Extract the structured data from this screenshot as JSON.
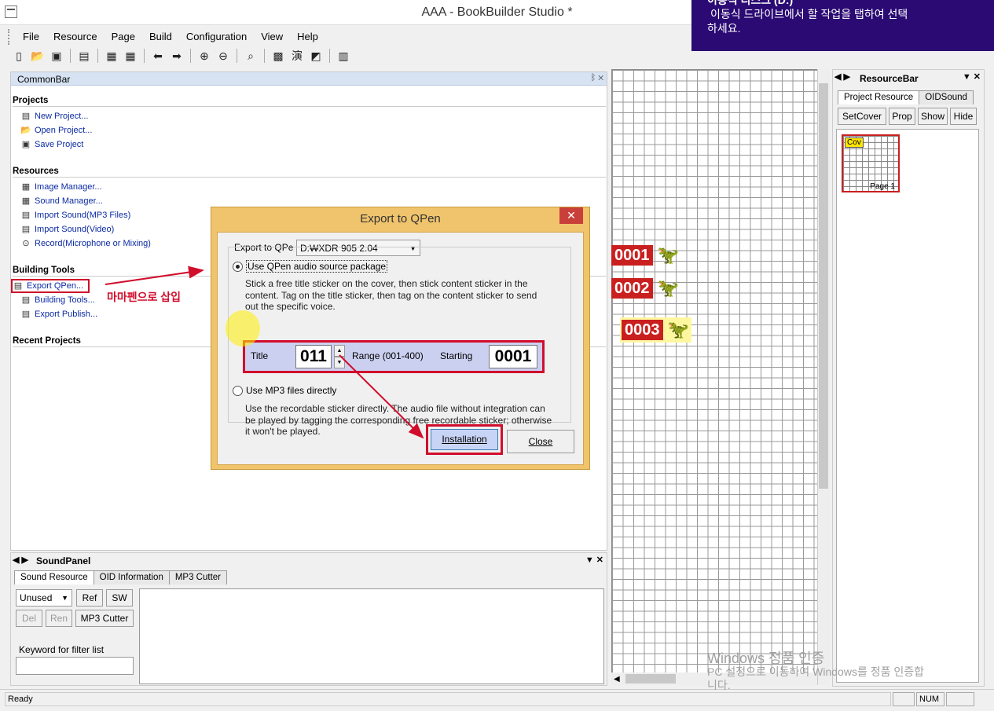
{
  "window": {
    "title": "AAA - BookBuilder Studio *"
  },
  "toast": {
    "line0": "이동식 디스크 (D:)",
    "line1": "이동식 드라이브에서 할 작업을 탭하여 선택",
    "line2": "하세요."
  },
  "menu": [
    "File",
    "Resource",
    "Page",
    "Build",
    "Configuration",
    "View",
    "Help"
  ],
  "commonbar": {
    "title": "CommonBar",
    "sections": {
      "projects": "Projects",
      "resources": "Resources",
      "building": "Building Tools",
      "recent": "Recent Projects"
    },
    "projects": [
      "New Project...",
      "Open Project...",
      "Save Project"
    ],
    "resources": [
      "Image Manager...",
      "Sound Manager...",
      "Import Sound(MP3 Files)",
      "Import Sound(Video)",
      "Record(Microphone or Mixing)"
    ],
    "building": [
      "Export QPen...",
      "Building Tools...",
      "Export Publish..."
    ]
  },
  "annotation": "마마펜으로 삽입",
  "dialog": {
    "title": "Export to QPen",
    "export_label": "Export to QPe",
    "drive": "D:₩XDR 905 2.04",
    "opt1": "Use QPen audio source package",
    "opt1_desc1": "Stick a free title sticker on the cover, then stick content sticker in the",
    "opt1_desc2": "content. Tag on the title sticker, then tag on the content sticker to send",
    "opt1_desc3": "out the specific voice.",
    "title_label": "Title",
    "title_value": "011",
    "range_label": "Range (001-400)",
    "starting_label": "Starting",
    "starting_value": "0001",
    "opt2": "Use MP3 files directly",
    "opt2_desc1": "Use the recordable sticker directly. The audio file without integration can",
    "opt2_desc2": "be played by tagging the corresponding free recordable sticker; otherwise",
    "opt2_desc3": "it won't be played.",
    "install": "Installation",
    "close": "Close"
  },
  "stickers": [
    "0001",
    "0002",
    "0003"
  ],
  "resourcebar": {
    "title": "ResourceBar",
    "tabs": [
      "Project Resource",
      "OIDSound"
    ],
    "buttons": [
      "SetCover",
      "Prop",
      "Show",
      "Hide"
    ],
    "cover_tag": "Cov",
    "page_label": "Page 1"
  },
  "soundpanel": {
    "title": "SoundPanel",
    "tabs": [
      "Sound Resource",
      "OID Information",
      "MP3 Cutter"
    ],
    "filter_value": "Unused",
    "buttons": [
      "Ref",
      "SW",
      "Del",
      "Ren",
      "MP3 Cutter"
    ],
    "keyword_label": "Keyword for filter list"
  },
  "status": {
    "text": "Ready",
    "num": "NUM"
  },
  "watermark": {
    "line1": "Windows 정품 인증",
    "line2": "PC 설정으로 이동하여 Windows를 정품 인증합",
    "line3": "니다."
  },
  "colors": {
    "accent": "#d10d2c",
    "toast_bg": "#2b0a73",
    "dialog_frame": "#f0c46c",
    "header_blue": "#d7e3f3"
  }
}
